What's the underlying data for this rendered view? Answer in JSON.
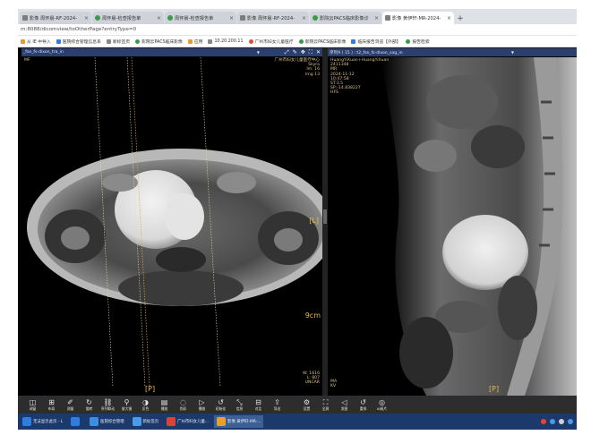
{
  "browser": {
    "tabs": [
      {
        "label": "影像 周怀晨-RF-2024-",
        "active": false,
        "favicon": "doc"
      },
      {
        "label": "周怀晨-检查报告单",
        "active": false,
        "favicon": "green"
      },
      {
        "label": "周怀晨-检查报告单",
        "active": false,
        "favicon": "green"
      },
      {
        "label": "影像 周怀晨-RF-2024-",
        "active": false,
        "favicon": "doc"
      },
      {
        "label": "影院云PACS临床影像诊",
        "active": false,
        "favicon": "green"
      },
      {
        "label": "影像 黄伊轩-MR-2024-",
        "active": true,
        "favicon": "doc"
      }
    ],
    "new_tab_label": "+",
    "close_label": "×",
    "address": "m:8088/dicomview/toOtherPage?entryType=0",
    "bookmarks": [
      {
        "label": "从 IE 中导入",
        "icon": "import-icon"
      },
      {
        "label": "医院综合管理信息系",
        "icon": "hospital-icon"
      },
      {
        "label": "新标签页",
        "icon": "page-icon"
      },
      {
        "label": "影院云PACS临床影像",
        "icon": "pacs-icon"
      },
      {
        "label": "应用",
        "icon": "apps-icon"
      },
      {
        "label": "10.20.200.11",
        "icon": "page-icon"
      },
      {
        "label": "广州市妇女儿童医疗",
        "icon": "hospital-icon"
      },
      {
        "label": "影院云PACS临床影像",
        "icon": "pacs-icon"
      },
      {
        "label": "临床报告浏览【外部】",
        "icon": "report-icon"
      },
      {
        "label": "报告检索",
        "icon": "search-icon"
      }
    ]
  },
  "viewer": {
    "left_pane": {
      "series": "_fse_fs-dixon_tra_in",
      "caret": "▼",
      "tools": [
        "⤢",
        "✎",
        "✥",
        "⛶",
        "✕"
      ],
      "top_left": [
        "MF"
      ],
      "top_right": [
        "广州市妇女儿童医疗中心",
        "Skyra",
        "Im: 16",
        "Img 13"
      ],
      "orient_right": "[L]",
      "orient_bottom": "[P]",
      "scale_label": "9cm",
      "bottom_right": [
        "W: 1616",
        "L: 807",
        "UNCAR"
      ]
    },
    "right_pane": {
      "series": "序列9 ( 15 ) : t2_fse_fs-dixon_sag_in",
      "caret": "▼",
      "top_left": [
        "HuangYiXuan+HuangYiXuan",
        "2411348",
        "MR",
        "2024-11-12",
        "10:47:58",
        "ST:3.5",
        "SP:-14.838227",
        "HFS"
      ],
      "bottom_left": [
        "MA",
        "KV"
      ],
      "orient_bottom": "[P]"
    }
  },
  "toolbar": {
    "buttons": [
      {
        "label": "调窗",
        "glyph": "◫",
        "icon": "window-level-icon"
      },
      {
        "label": "布局",
        "glyph": "⊞",
        "icon": "layout-icon"
      },
      {
        "label": "测量",
        "glyph": "✐",
        "icon": "measure-icon"
      },
      {
        "label": "旋转",
        "glyph": "↻",
        "icon": "rotate-icon"
      },
      {
        "label": "序列联动",
        "glyph": "⛓",
        "icon": "link-series-icon"
      },
      {
        "label": "放大镜",
        "glyph": "⚲",
        "icon": "magnifier-icon"
      },
      {
        "label": "反色",
        "glyph": "◑",
        "icon": "invert-icon"
      },
      {
        "label": "播放",
        "glyph": "▤",
        "icon": "cine-icon"
      },
      {
        "label": "伪彩",
        "glyph": "◌",
        "icon": "pseudo-color-icon"
      },
      {
        "label": "播放",
        "glyph": "▷",
        "icon": "play-icon"
      },
      {
        "label": "初始化",
        "glyph": "↺",
        "icon": "reset-icon"
      },
      {
        "label": "信息",
        "glyph": "⤡",
        "icon": "info-icon"
      },
      {
        "label": "对比",
        "glyph": "⊟",
        "icon": "compare-icon"
      },
      {
        "label": "导出",
        "glyph": "⇪",
        "icon": "export-icon"
      },
      {
        "label": "设置",
        "glyph": "⚙",
        "icon": "settings-icon"
      },
      {
        "label": "全屏",
        "glyph": "⛶",
        "icon": "fullscreen-icon"
      },
      {
        "label": "发图",
        "glyph": "◁",
        "icon": "send-image-icon"
      },
      {
        "label": "重排",
        "glyph": "↺",
        "icon": "rearrange-icon"
      },
      {
        "label": "AI阅片",
        "glyph": "◎",
        "icon": "ai-read-icon"
      }
    ]
  },
  "taskbar": {
    "items": [
      {
        "label": "无法显示此页 - L",
        "color": "#2f7de1"
      },
      {
        "label": "",
        "color": "#2f7de1"
      },
      {
        "label": "医院综合管理",
        "color": "#3d8de0"
      },
      {
        "label": "新标签页",
        "color": "#4a9be8"
      },
      {
        "label": "广州市妇女儿童...",
        "color": "#d9443a"
      },
      {
        "label": "影像 黄伊轩-MR-...",
        "color": "#e6a126"
      }
    ]
  }
}
